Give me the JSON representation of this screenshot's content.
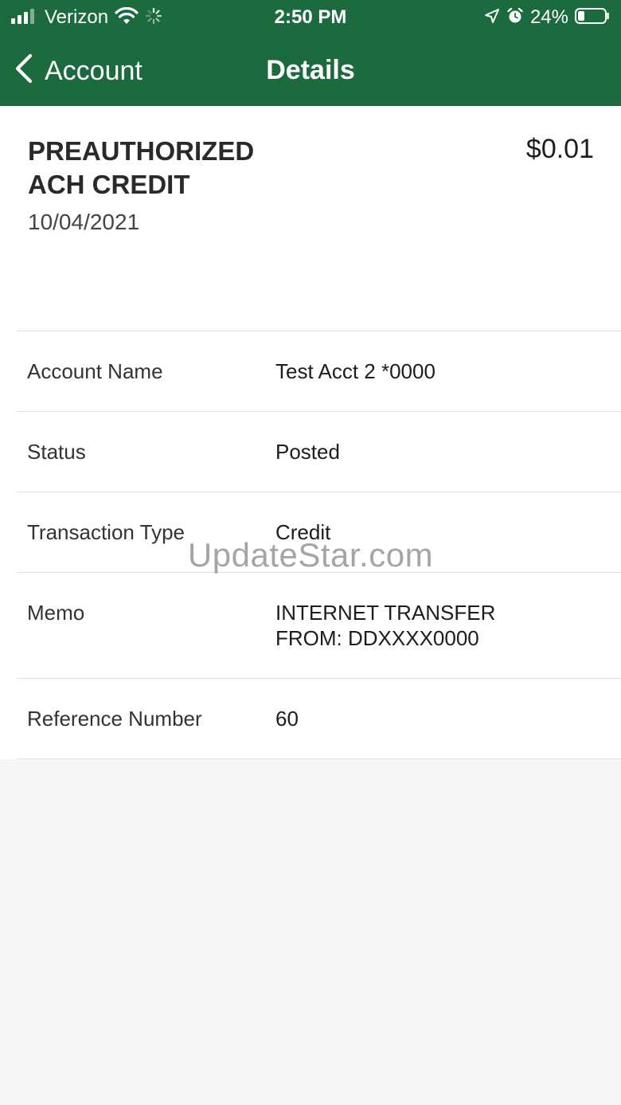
{
  "status_bar": {
    "carrier": "Verizon",
    "time": "2:50 PM",
    "battery_percent": "24%"
  },
  "nav": {
    "back_label": "Account",
    "title": "Details"
  },
  "transaction": {
    "title": "PREAUTHORIZED ACH CREDIT",
    "amount": "$0.01",
    "date": "10/04/2021"
  },
  "details": [
    {
      "label": "Account Name",
      "value": "Test Acct 2 *0000"
    },
    {
      "label": "Status",
      "value": "Posted"
    },
    {
      "label": "Transaction Type",
      "value": "Credit"
    },
    {
      "label": "Memo",
      "value": "INTERNET TRANSFER FROM: DDXXXX0000"
    },
    {
      "label": "Reference Number",
      "value": "60"
    }
  ],
  "watermark": "UpdateStar.com",
  "colors": {
    "header_green": "#1c6b3f",
    "page_background": "#f6f6f6"
  }
}
